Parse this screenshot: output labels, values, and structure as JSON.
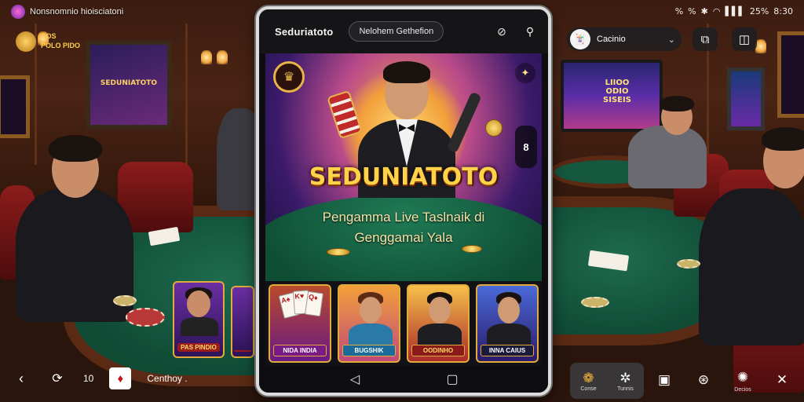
{
  "status_bar": {
    "app_title": "Nonsnomnio hioisciatoni",
    "indicators": [
      "%",
      "%",
      "✱",
      "◠",
      "▌▌▌",
      "25%",
      "8:30"
    ]
  },
  "logo_badge": {
    "text_line1": "COS",
    "text_line2": "POLO PIDO"
  },
  "background": {
    "wall_poster_text": "SEDUNIATOTO",
    "tv_text": "LIIOO ODIO SISEIS"
  },
  "left_cards": [
    {
      "label": "PAS PINDIO"
    },
    {
      "label": ""
    }
  ],
  "top_right": {
    "casino_select_label": "Cacinio",
    "casino_avatar_icon": "joker-icon"
  },
  "phone": {
    "brand": "Seduriatoto",
    "header_chip": "Nelohem Gethefion",
    "hero": {
      "title": "SEDUNIATOTO",
      "tagline_line1": "Pengamma Live Taslnaik di",
      "tagline_line2": "Genggamai  Yala",
      "side_button_text": "8",
      "emblem_icon": "crown-emblem-icon",
      "spark_icon": "sparkle-icon"
    },
    "thumbnails": [
      {
        "label": "NIDA INDIA",
        "kind": "cards"
      },
      {
        "label": "BUGSHIK",
        "kind": "host"
      },
      {
        "label": "OODINHO",
        "kind": "host"
      },
      {
        "label": "INNA CAIUS",
        "kind": "host"
      }
    ]
  },
  "bottom_bar": {
    "back_icon": "back-arrow-icon",
    "refresh_icon": "refresh-icon",
    "count": "10",
    "app_name": "Centhoy",
    "app_dot": "."
  },
  "bottom_right": [
    {
      "label": "Conse",
      "icon": "coin-icon"
    },
    {
      "label": "Tunnis",
      "icon": "gear-icon"
    },
    {
      "label": "",
      "icon": "save-icon"
    },
    {
      "label": "",
      "icon": "shield-icon"
    },
    {
      "label": "Decios",
      "icon": "settings-icon"
    },
    {
      "label": "",
      "icon": "close-icon"
    }
  ],
  "colors": {
    "accent_gold": "#ffd24a",
    "felt_green": "#1f6b4e",
    "wood_brown": "#5a2a14",
    "chair_red": "#8c1c1c"
  }
}
